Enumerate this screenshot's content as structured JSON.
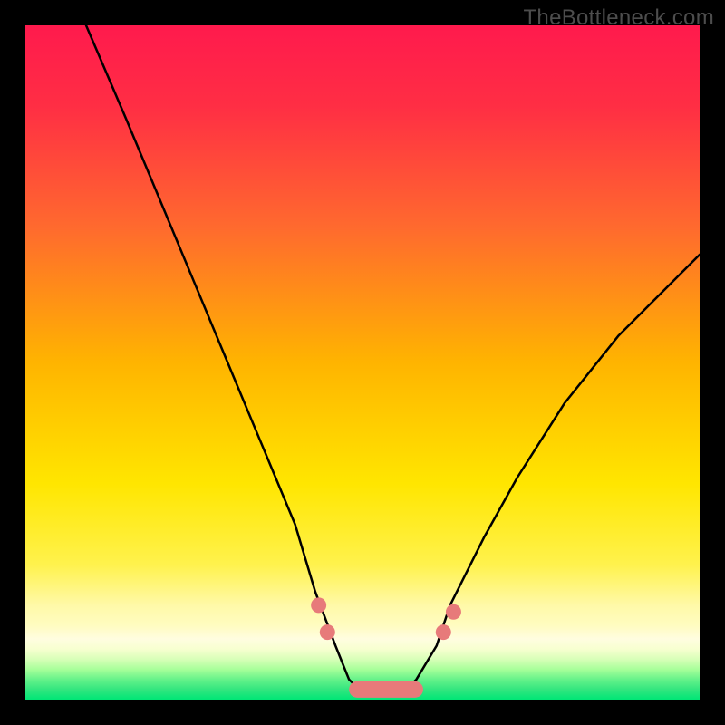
{
  "watermark": "TheBottleneck.com",
  "colors": {
    "frame": "#000000",
    "gradient_top": "#ff1a4d",
    "gradient_mid": "#ffd400",
    "gradient_bottom_band": "#fff8b0",
    "gradient_bottom": "#00e676",
    "curve_stroke": "#000000",
    "accent": "#e77a7a"
  },
  "chart_data": {
    "type": "line",
    "title": "",
    "xlabel": "",
    "ylabel": "",
    "xlim": [
      0,
      100
    ],
    "ylim": [
      0,
      100
    ],
    "grid": false,
    "legend": false,
    "series": [
      {
        "name": "bottleneck-curve",
        "x": [
          9,
          15,
          20,
          25,
          30,
          35,
          40,
          43,
          46,
          48,
          50,
          52,
          54,
          56,
          58,
          61,
          63,
          68,
          73,
          80,
          88,
          100
        ],
        "y": [
          100,
          86,
          74,
          62,
          50,
          38,
          26,
          16,
          8,
          3,
          1,
          0.5,
          0.5,
          1,
          3,
          8,
          14,
          24,
          33,
          44,
          54,
          66
        ]
      }
    ],
    "annotations": [
      {
        "name": "accent-dot-1",
        "x": 43.5,
        "y": 14,
        "kind": "dot"
      },
      {
        "name": "accent-dot-2",
        "x": 44.8,
        "y": 10,
        "kind": "dot"
      },
      {
        "name": "accent-segment-low",
        "x1": 48,
        "x2": 59,
        "y": 1.5,
        "kind": "thick-segment"
      },
      {
        "name": "accent-dot-3",
        "x": 62,
        "y": 10,
        "kind": "dot"
      },
      {
        "name": "accent-dot-4",
        "x": 63.5,
        "y": 13,
        "kind": "dot"
      }
    ]
  }
}
